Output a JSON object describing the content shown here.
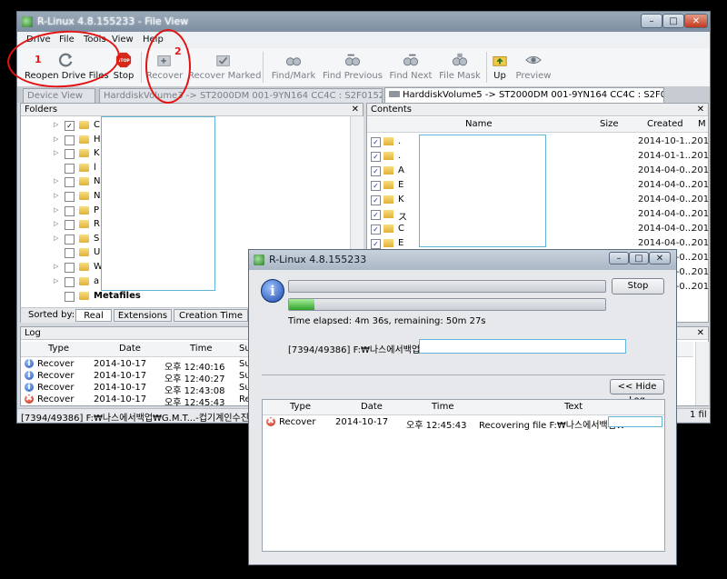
{
  "main_window": {
    "title": "R-Linux 4.8.155233 - File View",
    "menu": [
      "Drive",
      "File",
      "Tools",
      "View",
      "Help"
    ],
    "toolbar": [
      {
        "label": "Reopen Drive Files",
        "icon": "refresh-icon"
      },
      {
        "label": "Stop",
        "icon": "stop-icon"
      },
      {
        "label": "Recover",
        "icon": "recover-icon"
      },
      {
        "label": "Recover Marked",
        "icon": "recover-marked-icon"
      },
      {
        "label": "Find/Mark",
        "icon": "binoculars-icon"
      },
      {
        "label": "Find Previous",
        "icon": "find-previous-icon"
      },
      {
        "label": "Find Next",
        "icon": "find-next-icon"
      },
      {
        "label": "File Mask",
        "icon": "file-mask-icon"
      },
      {
        "label": "Up",
        "icon": "folder-up-icon"
      },
      {
        "label": "Preview",
        "icon": "preview-icon"
      }
    ],
    "stop_icon_text": "STOP",
    "tabs": [
      {
        "label": "Device View"
      },
      {
        "label": "HarddiskVolume3 -> ST2000DM 001-9YN164 CC4C : S2F0152P"
      },
      {
        "label": "HarddiskVolume5 -> ST2000DM 001-9YN164 CC4C : S2F0152P"
      }
    ],
    "folders": {
      "title": "Folders",
      "items": [
        {
          "name": "C",
          "checked": true,
          "has_arrow": true
        },
        {
          "name": "H",
          "checked": false,
          "has_arrow": true
        },
        {
          "name": "K",
          "checked": false,
          "has_arrow": true
        },
        {
          "name": "l",
          "checked": false,
          "has_arrow": false
        },
        {
          "name": "N",
          "checked": false,
          "has_arrow": true
        },
        {
          "name": "N",
          "checked": false,
          "has_arrow": true
        },
        {
          "name": "P",
          "checked": false,
          "has_arrow": true
        },
        {
          "name": "R",
          "checked": false,
          "has_arrow": true
        },
        {
          "name": "S",
          "checked": false,
          "has_arrow": true
        },
        {
          "name": "U",
          "checked": false,
          "has_arrow": false
        },
        {
          "name": "W",
          "checked": false,
          "has_arrow": true
        },
        {
          "name": "a",
          "checked": false,
          "has_arrow": true
        }
      ],
      "metafiles": "Metafiles",
      "sorted_by_label": "Sorted by:",
      "sort_options": [
        "Real",
        "Extensions",
        "Creation Time"
      ]
    },
    "contents": {
      "title": "Contents",
      "columns": [
        "Name",
        "Size",
        "Created",
        "M"
      ],
      "rows": [
        {
          "name": ".",
          "created": "2014-10-1...",
          "m": "201"
        },
        {
          "name": ".",
          "created": "2014-01-1...",
          "m": "201"
        },
        {
          "name": "A",
          "created": "2014-04-0...",
          "m": "201"
        },
        {
          "name": "E",
          "created": "2014-04-0...",
          "m": "201"
        },
        {
          "name": "K",
          "created": "2014-04-0...",
          "m": "201"
        },
        {
          "name": "ス",
          "created": "2014-04-0...",
          "m": "201"
        },
        {
          "name": "C",
          "created": "2014-04-0...",
          "m": "201"
        },
        {
          "name": "E",
          "created": "2014-04-0...",
          "m": "201"
        },
        {
          "name": "",
          "created": "2014-04-0...",
          "m": "201"
        },
        {
          "name": "",
          "created": "2014-04-0...",
          "m": "201"
        },
        {
          "name": "",
          "created": "2014-04-0...",
          "m": "201"
        }
      ]
    },
    "log": {
      "title": "Log",
      "columns": [
        "Type",
        "Date",
        "Time",
        "Su"
      ],
      "rows": [
        {
          "type": "Recover",
          "date": "2014-10-17",
          "time": "오후 12:40:16",
          "extra": "Su",
          "kind": "info"
        },
        {
          "type": "Recover",
          "date": "2014-10-17",
          "time": "오후 12:40:27",
          "extra": "Su",
          "kind": "info"
        },
        {
          "type": "Recover",
          "date": "2014-10-17",
          "time": "오후 12:43:08",
          "extra": "Su",
          "kind": "info"
        },
        {
          "type": "Recover",
          "date": "2014-10-17",
          "time": "오후 12:45:43",
          "extra": "Re",
          "kind": "error"
        }
      ]
    },
    "status": {
      "left": "[7394/49386] F:₩나스에서백업₩G.M.T...-컵기계인수진행₩",
      "right": "1 fil"
    }
  },
  "dialog": {
    "title": "R-Linux 4.8.155233",
    "stop_label": "Stop",
    "progress_top": 0.0,
    "progress_bottom": 0.08,
    "elapsed": "Time elapsed: 4m 36s, remaining: 50m 27s",
    "current_file": "[7394/49386]  F:₩나스에서백업₩",
    "hide_log_label": "<< Hide Log",
    "log_columns": [
      "Type",
      "Date",
      "Time",
      "Text"
    ],
    "log_rows": [
      {
        "type": "Recover",
        "date": "2014-10-17",
        "time": "오후 12:45:43",
        "text": "Recovering file F:₩나스에서백업₩"
      }
    ]
  },
  "annotations": [
    "1",
    "2"
  ],
  "colors": {
    "annotation": "#e31313",
    "progress_fill": "#2ea22a",
    "redaction_border": "#62b5d9"
  }
}
